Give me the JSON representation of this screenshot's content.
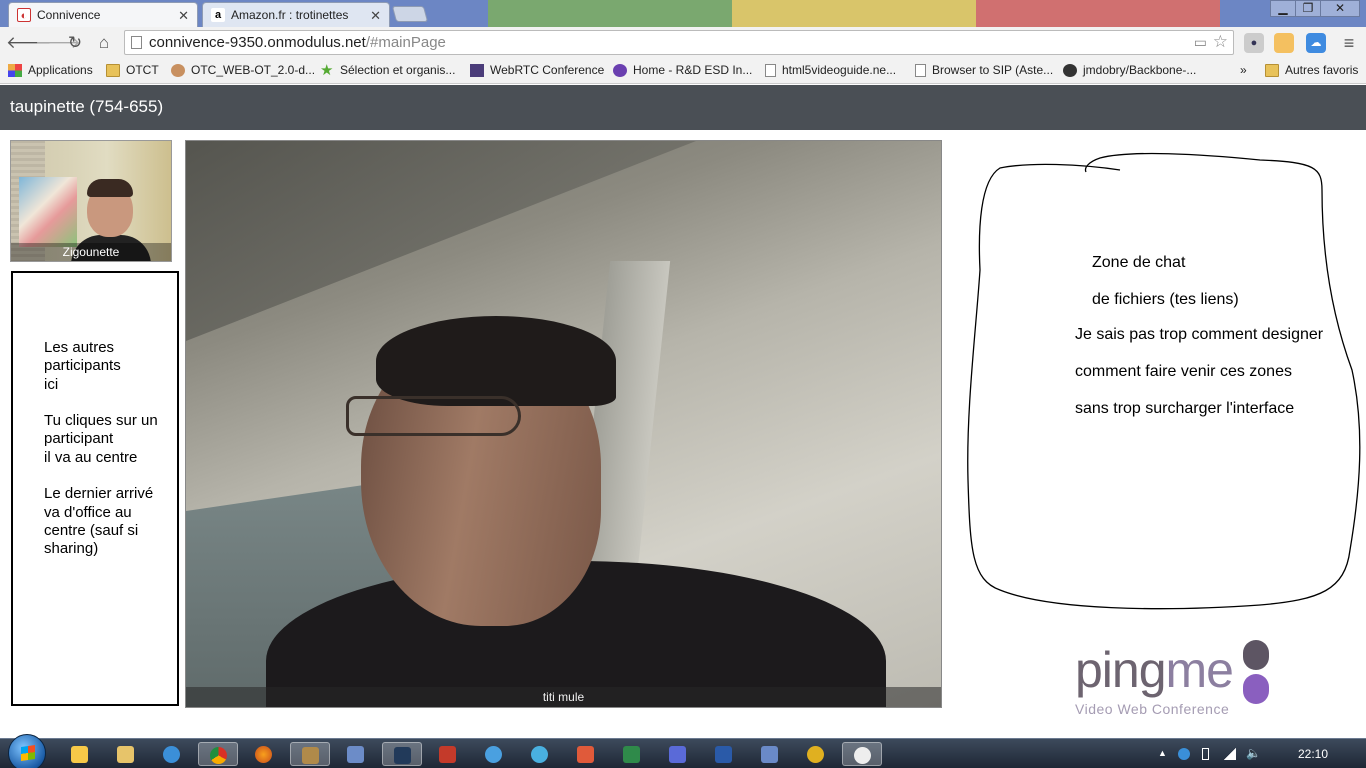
{
  "browser": {
    "tabs": [
      {
        "label": "Connivence",
        "active": true
      },
      {
        "label": "Amazon.fr : trotinettes",
        "active": false
      }
    ],
    "url_host": "connivence-9350.onmodulus.net",
    "url_path": "/#mainPage",
    "window_controls": [
      "minimize",
      "restore",
      "close"
    ]
  },
  "bookmarks": {
    "items": [
      {
        "label": "Applications",
        "icon": "apps-grid-icon"
      },
      {
        "label": "OTCT",
        "icon": "folder-icon"
      },
      {
        "label": "OTC_WEB-OT_2.0-d...",
        "icon": "user-icon"
      },
      {
        "label": "Sélection et organis...",
        "icon": "star-icon"
      },
      {
        "label": "WebRTC Conference",
        "icon": "webrtc-icon"
      },
      {
        "label": "Home - R&D ESD In...",
        "icon": "circle-logo-icon"
      },
      {
        "label": "html5videoguide.ne...",
        "icon": "page-icon"
      },
      {
        "label": "Browser to SIP (Aste...",
        "icon": "page-icon"
      },
      {
        "label": "jmdobry/Backbone-...",
        "icon": "github-icon"
      }
    ],
    "overflow": "»",
    "other": "Autres favoris"
  },
  "app": {
    "room_title": "taupinette (754-655)",
    "self_name": "Zigounette",
    "main_speaker_name": "titi mule",
    "participants_note": [
      "Les autres\nparticipants\nici",
      "Tu cliques sur un\nparticipant\nil va au centre",
      "Le dernier arrivé\nva d'office au\ncentre (sauf si\nsharing)"
    ],
    "chat_note": [
      "Zone de chat",
      "de fichiers (tes liens)",
      "Je sais pas trop comment designer",
      "comment faire venir ces zones",
      "sans trop surcharger l'interface"
    ],
    "logo": {
      "ping": "ping",
      "me": "me",
      "subtitle": "Video Web Conference",
      "color_primary": "#6d6470",
      "color_accent": "#8c7fa0"
    }
  },
  "taskbar": {
    "clock": "22:10"
  }
}
